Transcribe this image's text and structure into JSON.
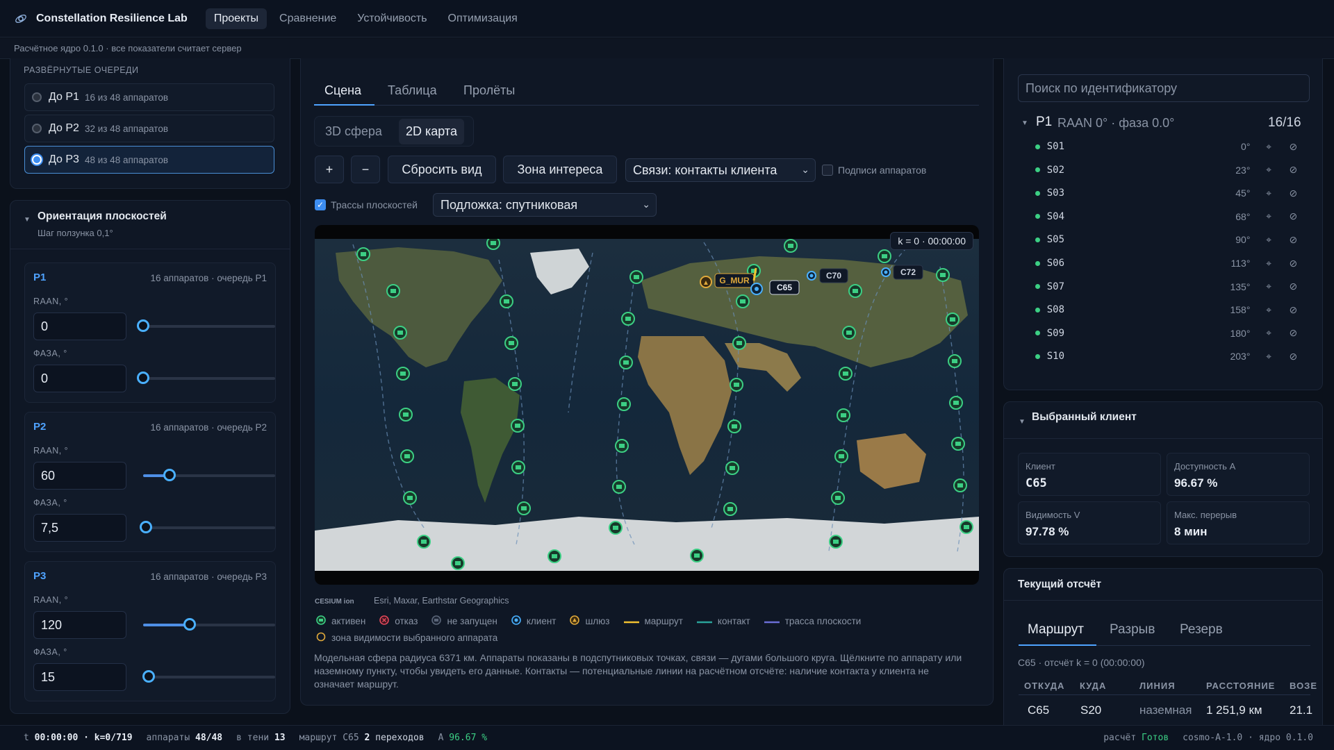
{
  "app": {
    "title": "Constellation Resilience Lab"
  },
  "nav": {
    "tabs": [
      "Проекты",
      "Сравнение",
      "Устойчивость",
      "Оптимизация"
    ],
    "active": 0
  },
  "subbar": {
    "text": "Расчётное ядро 0.1.0 · все показатели считает сервер"
  },
  "queues": {
    "caption": "РАЗВЁРНУТЫЕ ОЧЕРЕДИ",
    "items": [
      {
        "label": "До P1",
        "sub": "16 из 48 аппаратов",
        "selected": false
      },
      {
        "label": "До P2",
        "sub": "32 из 48 аппаратов",
        "selected": false
      },
      {
        "label": "До P3",
        "sub": "48 из 48 аппаратов",
        "selected": true
      }
    ]
  },
  "orientation": {
    "title": "Ориентация плоскостей",
    "subtitle": "Шаг ползунка 0,1°",
    "raan_label": "RAAN, °",
    "phase_label": "ФАЗА, °",
    "planes": [
      {
        "name": "P1",
        "info": "16 аппаратов · очередь P1",
        "raan": "0",
        "phase": "0",
        "raan_fraction": 0.0,
        "phase_fraction": 0.0
      },
      {
        "name": "P2",
        "info": "16 аппаратов · очередь P2",
        "raan": "60",
        "phase": "7,5",
        "raan_fraction": 0.2,
        "phase_fraction": 0.02
      },
      {
        "name": "P3",
        "info": "16 аппаратов · очередь P3",
        "raan": "120",
        "phase": "15",
        "raan_fraction": 0.35,
        "phase_fraction": 0.04
      }
    ]
  },
  "scene": {
    "tabs": [
      "Сцена",
      "Таблица",
      "Пролёты"
    ],
    "active_tab": 0,
    "view_toggle": [
      "3D сфера",
      "2D карта"
    ],
    "active_view": 1,
    "buttons": {
      "zoom_in": "+",
      "zoom_out": "−",
      "reset": "Сбросить вид",
      "aoi": "Зона интереса"
    },
    "links_select": "Связи: контакты клиента",
    "labels_checkbox": {
      "label": "Подписи аппаратов",
      "checked": false
    },
    "tracks_checkbox": {
      "label": "Трассы плоскостей",
      "checked": true
    },
    "basemap_select": "Подложка: спутниковая",
    "time_badge": "k = 0 · 00:00:00",
    "attribution": "Esri, Maxar, Earthstar Geographics",
    "cesium_logo": "CESIUM ion",
    "map_labels": {
      "gateway": "G_MUR",
      "client_selected": "C65",
      "client2": "C70",
      "client3": "C72"
    },
    "legend": [
      {
        "icon": "active-sat-icon",
        "label": "активен"
      },
      {
        "icon": "failed-sat-icon",
        "label": "отказ"
      },
      {
        "icon": "not-launched-icon",
        "label": "не запущен"
      },
      {
        "icon": "client-icon",
        "label": "клиент"
      },
      {
        "icon": "gateway-icon",
        "label": "шлюз"
      },
      {
        "icon": "route-line-icon",
        "label": "маршрут",
        "color": "#f2c230"
      },
      {
        "icon": "contact-line-icon",
        "label": "контакт",
        "color": "#2aa39a"
      },
      {
        "icon": "track-line-icon",
        "label": "трасса плоскости",
        "color": "#6b6fd6"
      },
      {
        "icon": "visibility-zone-icon",
        "label": "зона видимости выбранного аппарата"
      }
    ],
    "description": "Модельная сфера радиуса 6371 км. Аппараты показаны в подспутниковых точках, связи — дугами большого круга. Щёлкните по аппарату или наземному пункту, чтобы увидеть его данные. Контакты — потенциальные линии на расчётном отсчёте: наличие контакта у клиента не означает маршрут."
  },
  "right": {
    "search_placeholder": "Поиск по идентификатору",
    "plane_group": {
      "name": "P1",
      "desc": "RAAN 0° · фаза 0.0°",
      "count": "16/16"
    },
    "satellites": [
      {
        "id": "S01",
        "angle": "0°"
      },
      {
        "id": "S02",
        "angle": "23°"
      },
      {
        "id": "S03",
        "angle": "45°"
      },
      {
        "id": "S04",
        "angle": "68°"
      },
      {
        "id": "S05",
        "angle": "90°"
      },
      {
        "id": "S06",
        "angle": "113°"
      },
      {
        "id": "S07",
        "angle": "135°"
      },
      {
        "id": "S08",
        "angle": "158°"
      },
      {
        "id": "S09",
        "angle": "180°"
      },
      {
        "id": "S10",
        "angle": "203°"
      }
    ],
    "client": {
      "title": "Выбранный клиент",
      "stats": [
        {
          "label": "Клиент",
          "value": "C65"
        },
        {
          "label": "Доступность A",
          "value": "96.67 %"
        },
        {
          "label": "Видимость V",
          "value": "97.78 %"
        },
        {
          "label": "Макс. перерыв",
          "value": "8 мин"
        }
      ]
    },
    "current": {
      "title": "Текущий отсчёт",
      "tabs": [
        "Маршрут",
        "Разрыв",
        "Резерв"
      ],
      "active_tab": 0,
      "sub": "C65 · отсчёт k = 0 (00:00:00)",
      "columns": [
        "ОТКУДА",
        "КУДА",
        "ЛИНИЯ",
        "РАССТОЯНИЕ",
        "ВОЗЕ"
      ],
      "row": [
        "C65",
        "S20",
        "наземная",
        "1 251,9 км",
        "21.1"
      ]
    }
  },
  "status": {
    "time_label": "t",
    "time": "00:00:00 · k=0/719",
    "sats_label": "аппараты",
    "sats": "48/48",
    "shadow_label": "в тени",
    "shadow": "13",
    "route_label": "маршрут C65",
    "route_val": "2",
    "route_unit": "переходов",
    "a_label": "A",
    "a_val": "96.67 %",
    "calc_label": "расчёт",
    "calc_val": "Готов",
    "version": "cosmo-A-1.0 · ядро 0.1.0"
  },
  "colors": {
    "accent": "#4fa3ff",
    "active": "#3ccf84",
    "gateway": "#e0a93b",
    "client": "#4ab0ff"
  }
}
